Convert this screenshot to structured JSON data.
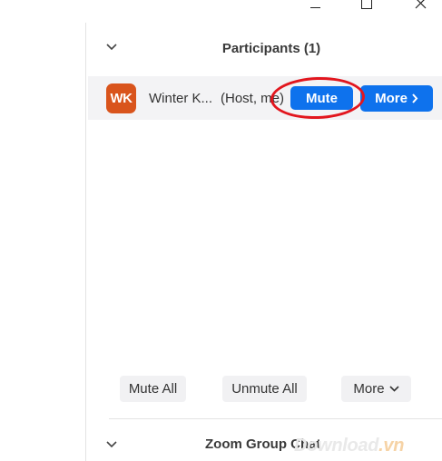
{
  "window_controls": {
    "minimize_icon": "minimize-icon",
    "maximize_icon": "maximize-icon",
    "close_icon": "close-icon"
  },
  "participants_panel": {
    "title": "Participants (1)",
    "collapse_icon": "chevron-down-icon",
    "participants": [
      {
        "initials": "WK",
        "avatar_color": "#d9541c",
        "name": "Winter K...",
        "role": "(Host, me)",
        "mute_label": "Mute",
        "more_label": "More",
        "more_icon": "chevron-right-icon"
      }
    ]
  },
  "actions": {
    "mute_all": "Mute All",
    "unmute_all": "Unmute All",
    "more": "More",
    "more_icon": "chevron-down-icon"
  },
  "chat_panel": {
    "title": "Zoom Group Chat",
    "collapse_icon": "chevron-down-icon"
  },
  "watermark": {
    "text_main": "Download",
    "text_suffix": ".vn"
  },
  "colors": {
    "accent_blue": "#0e72ed",
    "highlight_red": "#e2161e",
    "row_bg": "#f3f3f5"
  }
}
